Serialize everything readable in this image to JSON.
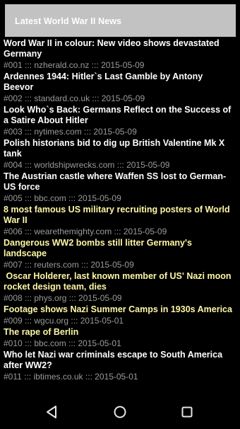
{
  "app_bar": {
    "title": "Latest World War II News"
  },
  "news": [
    {
      "headline": "Word War II in colour: New video shows devastated Germany",
      "meta": "#001 ::: nzherald.co.nz ::: 2015-05-09",
      "highlighted": false
    },
    {
      "headline": "Ardennes 1944: Hitler`s Last Gamble by Antony Beevor",
      "meta": "#002 ::: standard.co.uk ::: 2015-05-09",
      "highlighted": false
    },
    {
      "headline": "Look Who`s Back: Germans Reflect on the Success of a Satire About Hitler",
      "meta": "#003 ::: nytimes.com ::: 2015-05-09",
      "highlighted": false
    },
    {
      "headline": "Polish historians bid to dig up British Valentine Mk X tank",
      "meta": "#004 ::: worldshipwrecks.com ::: 2015-05-09",
      "highlighted": false
    },
    {
      "headline": "The Austrian castle where Waffen SS lost to German-US force",
      "meta": "#005 ::: bbc.com ::: 2015-05-09",
      "highlighted": false
    },
    {
      "headline": "8 most famous US military recruiting posters of World War II",
      "meta": "#006 ::: wearethemighty.com ::: 2015-05-09",
      "highlighted": true
    },
    {
      "headline": "Dangerous WW2 bombs still litter Germany's landscape",
      "meta": "#007 ::: reuters.com ::: 2015-05-09",
      "highlighted": true
    },
    {
      "headline": " Oscar Holderer, last known member of US' Nazi moon rocket design team, dies",
      "meta": "#008 ::: phys.org ::: 2015-05-09",
      "highlighted": true
    },
    {
      "headline": "Footage shows Nazi Summer Camps in 1930s America",
      "meta": "#009 ::: wgcu.org ::: 2015-05-01",
      "highlighted": true
    },
    {
      "headline": "The rape of Berlin",
      "meta": "#010 ::: bbc.com ::: 2015-05-01",
      "highlighted": true
    },
    {
      "headline": "Who let Nazi war criminals escape to South America after WW2?",
      "meta": "#011 ::: ibtimes.co.uk ::: 2015-05-01",
      "highlighted": false
    }
  ],
  "nav": {
    "back_icon": "triangle-back-icon",
    "home_icon": "circle-home-icon",
    "recent_icon": "square-recent-apps-icon",
    "icon_color": "#e6e6e6"
  },
  "colors": {
    "background": "#000000",
    "app_bar": "#c2c2c2",
    "headline": "#ffffff",
    "headline_highlight": "#fdf7a6",
    "meta": "#9a9a9a"
  }
}
